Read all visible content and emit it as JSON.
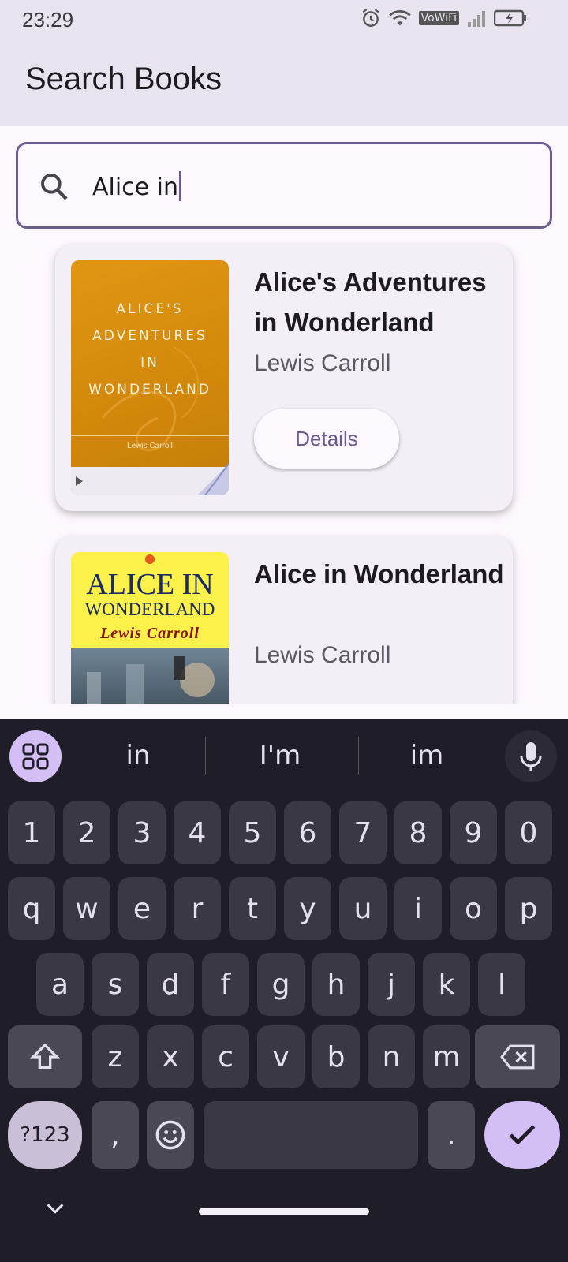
{
  "status_bar": {
    "time": "23:29",
    "vowifi_label": "VoWiFi"
  },
  "app_bar": {
    "title": "Search Books"
  },
  "search": {
    "value": "Alice in"
  },
  "results": [
    {
      "title": "Alice's Adventures in Wonderland",
      "author": "Lewis Carroll",
      "button": "Details",
      "cover_text": [
        "ALICE'S",
        "ADVENTURES",
        "IN",
        "WONDERLAND"
      ],
      "cover_author": "Lewis Carroll"
    },
    {
      "title": "Alice in Wonderland",
      "author": "Lewis Carroll",
      "cover_text": [
        "ALICE IN",
        "WONDERLAND",
        "Lewis Carroll"
      ]
    }
  ],
  "keyboard": {
    "suggestions": [
      "in",
      "I'm",
      "im"
    ],
    "number_row": [
      "1",
      "2",
      "3",
      "4",
      "5",
      "6",
      "7",
      "8",
      "9",
      "0"
    ],
    "row1": [
      "q",
      "w",
      "e",
      "r",
      "t",
      "y",
      "u",
      "i",
      "o",
      "p"
    ],
    "row2": [
      "a",
      "s",
      "d",
      "f",
      "g",
      "h",
      "j",
      "k",
      "l"
    ],
    "row3": [
      "z",
      "x",
      "c",
      "v",
      "b",
      "n",
      "m"
    ],
    "symbols_key": "?123",
    "comma_key": ",",
    "period_key": "."
  }
}
